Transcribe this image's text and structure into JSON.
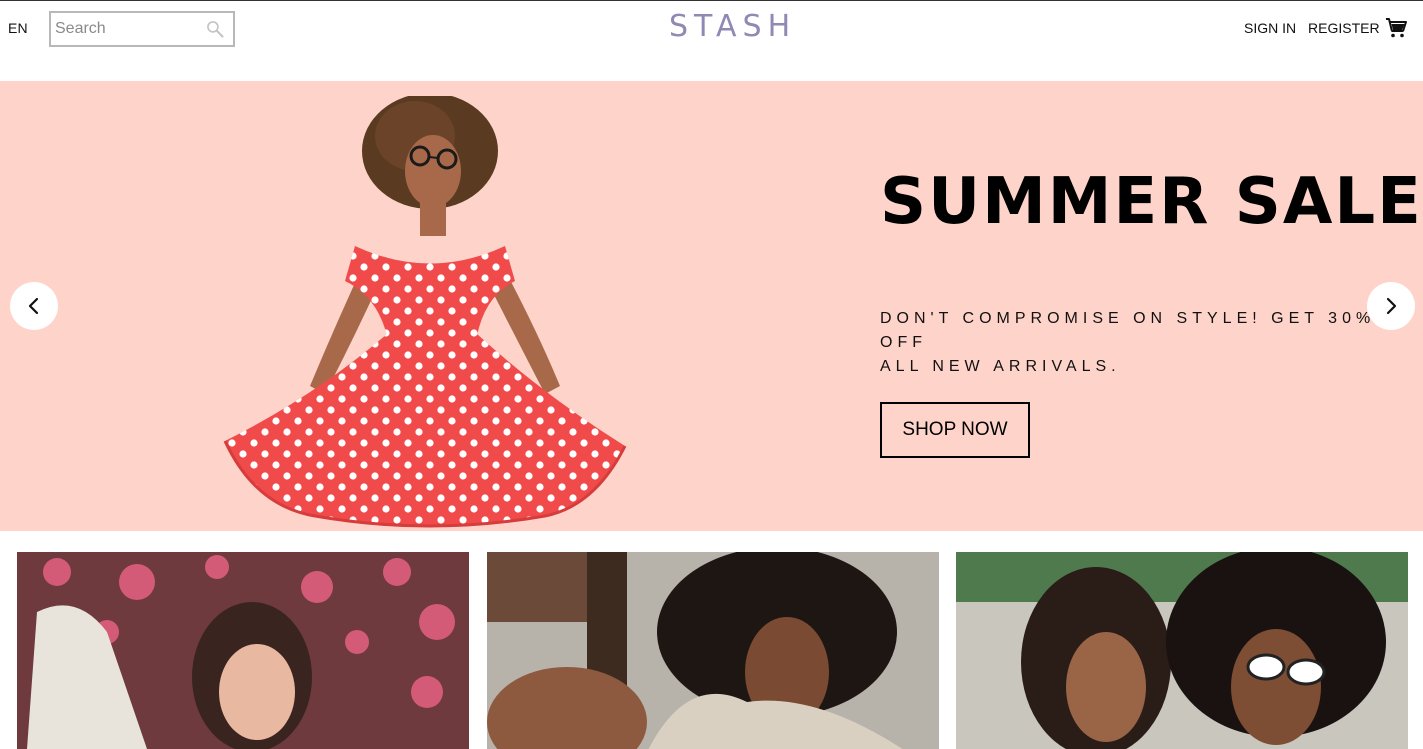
{
  "header": {
    "language": "EN",
    "search": {
      "placeholder": "Search",
      "value": ""
    },
    "logo": "STASH",
    "sign_in": "SIGN IN",
    "register": "REGISTER"
  },
  "hero": {
    "title": "SUMMER SALE",
    "subtitle": "DON'T COMPROMISE ON STYLE! GET 30% OFF\nALL NEW ARRIVALS.",
    "button": "SHOP NOW",
    "background_color": "#fed4ca",
    "image": "woman-in-red-polka-dot-dress",
    "prev_icon": "chevron-left-icon",
    "next_icon": "chevron-right-icon"
  },
  "categories": [
    {
      "image": "woman-under-blossom-tree"
    },
    {
      "image": "woman-in-cream-sweater"
    },
    {
      "image": "two-women-with-sunglasses"
    }
  ],
  "colors": {
    "logo": "#8f89b4",
    "accent_orange": "#f0a07a"
  }
}
